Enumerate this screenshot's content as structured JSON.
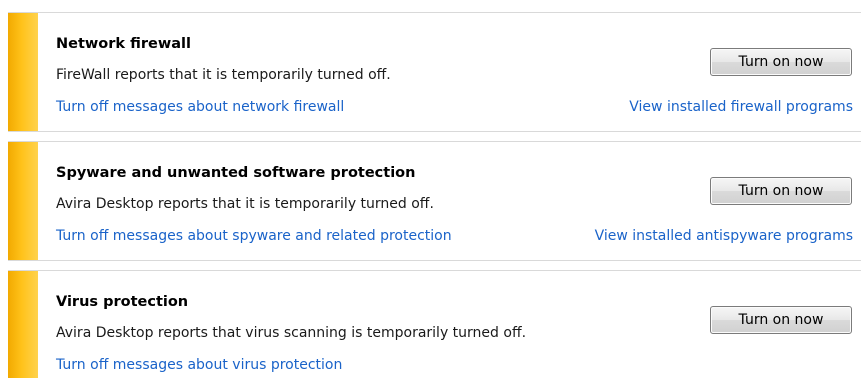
{
  "colors": {
    "accent_stripe": "#ffc21a",
    "link": "#1a63c9",
    "divider": "#d9d9d9"
  },
  "sections": [
    {
      "title": "Network firewall",
      "description": "FireWall reports that it is temporarily turned off.",
      "button_label": "Turn on now",
      "link_left": "Turn off messages about network firewall",
      "link_right": "View installed firewall programs"
    },
    {
      "title": "Spyware and unwanted software protection",
      "description": "Avira Desktop reports that it is temporarily turned off.",
      "button_label": "Turn on now",
      "link_left": "Turn off messages about spyware and related protection",
      "link_right": "View installed antispyware programs"
    },
    {
      "title": "Virus protection",
      "description": "Avira Desktop reports that virus scanning is temporarily turned off.",
      "button_label": "Turn on now",
      "link_left": "Turn off messages about virus protection"
    }
  ]
}
